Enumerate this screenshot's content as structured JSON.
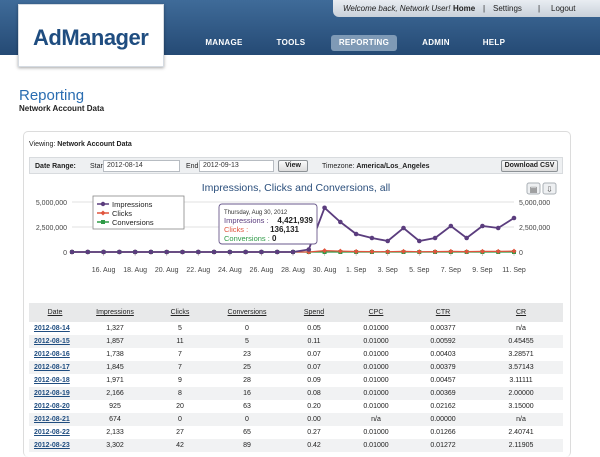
{
  "header": {
    "logo": "AdManager",
    "welcome": "Welcome back, Network User!",
    "home": "Home",
    "settings": "Settings",
    "logout": "Logout",
    "separator": "|",
    "nav": [
      "MANAGE",
      "TOOLS",
      "REPORTING",
      "ADMIN",
      "HELP"
    ],
    "active_nav": "REPORTING"
  },
  "page": {
    "title": "Reporting",
    "subtitle": "Network Account Data"
  },
  "viewing": {
    "label": "Viewing:",
    "value": "Network Account Data"
  },
  "filters": {
    "date_range_label": "Date Range:",
    "start_label": "Start",
    "start_value": "2012-08-14",
    "end_label": "End",
    "end_value": "2012-09-13",
    "view_button": "View",
    "timezone_label": "Timezone:",
    "timezone_value": "America/Los_Angeles",
    "download_button": "Download CSV"
  },
  "chart_data": {
    "type": "line",
    "title": "Impressions, Clicks and Conversions, all",
    "x": [
      "2012-08-14",
      "2012-08-15",
      "2012-08-16",
      "2012-08-17",
      "2012-08-18",
      "2012-08-19",
      "2012-08-20",
      "2012-08-21",
      "2012-08-22",
      "2012-08-23",
      "2012-08-24",
      "2012-08-25",
      "2012-08-26",
      "2012-08-27",
      "2012-08-28",
      "2012-08-29",
      "2012-08-30",
      "2012-08-31",
      "2012-09-01",
      "2012-09-02",
      "2012-09-03",
      "2012-09-04",
      "2012-09-05",
      "2012-09-06",
      "2012-09-07",
      "2012-09-08",
      "2012-09-09",
      "2012-09-10",
      "2012-09-11"
    ],
    "x_tick_labels": [
      "16. Aug",
      "18. Aug",
      "20. Aug",
      "22. Aug",
      "24. Aug",
      "26. Aug",
      "28. Aug",
      "30. Aug",
      "1. Sep",
      "3. Sep",
      "5. Sep",
      "7. Sep",
      "9. Sep",
      "11. Sep"
    ],
    "y_tick_labels": [
      "0",
      "2,500,000",
      "5,000,000"
    ],
    "ylim": [
      0,
      5000000
    ],
    "series": [
      {
        "name": "Impressions",
        "color": "#5b3d7e",
        "values": [
          1327,
          1857,
          1738,
          1845,
          1971,
          2166,
          925,
          674,
          2133,
          3302,
          1900,
          1500,
          1400,
          1700,
          1600,
          250000,
          4421939,
          3000000,
          1800000,
          1400000,
          1100000,
          2400000,
          1100000,
          1400000,
          2600000,
          1400000,
          2600000,
          2400000,
          3400000
        ]
      },
      {
        "name": "Clicks",
        "color": "#e0543d",
        "values": [
          5,
          11,
          7,
          7,
          9,
          16,
          20,
          0,
          27,
          42,
          10,
          8,
          7,
          9,
          8,
          1000,
          136131,
          90000,
          50000,
          40000,
          30000,
          60000,
          30000,
          35000,
          65000,
          35000,
          65000,
          60000,
          85000
        ]
      },
      {
        "name": "Conversions",
        "color": "#2e9a46",
        "values": [
          0,
          5,
          23,
          25,
          28,
          8,
          63,
          0,
          65,
          89,
          20,
          15,
          12,
          18,
          16,
          0,
          0,
          0,
          0,
          0,
          0,
          0,
          0,
          0,
          0,
          0,
          0,
          0,
          0
        ]
      }
    ],
    "tooltip": {
      "date": "Thursday, Aug 30, 2012",
      "impressions_label": "Impressions :",
      "impressions_value": "4,421,939",
      "clicks_label": "Clicks :",
      "clicks_value": "136,131",
      "conversions_label": "Conversions :",
      "conversions_value": "0"
    },
    "legend": [
      "Impressions",
      "Clicks",
      "Conversions"
    ],
    "legend_position": "top-left"
  },
  "table": {
    "columns": [
      "Date",
      "Impressions",
      "Clicks",
      "Conversions",
      "Spend",
      "CPC",
      "CTR",
      "CR"
    ],
    "rows": [
      [
        "2012-08-14",
        "1,327",
        "5",
        "0",
        "0.05",
        "0.01000",
        "0.00377",
        "n/a"
      ],
      [
        "2012-08-15",
        "1,857",
        "11",
        "5",
        "0.11",
        "0.01000",
        "0.00592",
        "0.45455"
      ],
      [
        "2012-08-16",
        "1,738",
        "7",
        "23",
        "0.07",
        "0.01000",
        "0.00403",
        "3.28571"
      ],
      [
        "2012-08-17",
        "1,845",
        "7",
        "25",
        "0.07",
        "0.01000",
        "0.00379",
        "3.57143"
      ],
      [
        "2012-08-18",
        "1,971",
        "9",
        "28",
        "0.09",
        "0.01000",
        "0.00457",
        "3.11111"
      ],
      [
        "2012-08-19",
        "2,166",
        "8",
        "16",
        "0.08",
        "0.01000",
        "0.00369",
        "2.00000"
      ],
      [
        "2012-08-20",
        "925",
        "20",
        "63",
        "0.20",
        "0.01000",
        "0.02162",
        "3.15000"
      ],
      [
        "2012-08-21",
        "674",
        "0",
        "0",
        "0.00",
        "n/a",
        "0.00000",
        "n/a"
      ],
      [
        "2012-08-22",
        "2,133",
        "27",
        "65",
        "0.27",
        "0.01000",
        "0.01266",
        "2.40741"
      ],
      [
        "2012-08-23",
        "3,302",
        "42",
        "89",
        "0.42",
        "0.01000",
        "0.01272",
        "2.11905"
      ]
    ]
  }
}
